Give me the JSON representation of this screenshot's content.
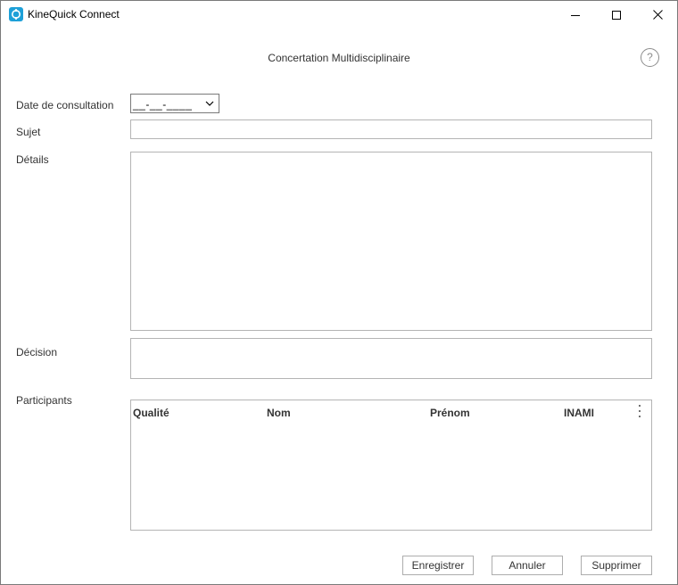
{
  "window": {
    "title": "KineQuick Connect",
    "icon": "kinequick-app-icon",
    "controls": [
      "minimize-icon",
      "maximize-icon",
      "close-icon"
    ]
  },
  "dialog": {
    "title": "Concertation Multidisciplinaire",
    "help_label": "?"
  },
  "form": {
    "date_label": "Date de consultation",
    "date_value": "__-__-____",
    "subject_label": "Sujet",
    "subject_value": "",
    "details_label": "Détails",
    "details_value": "",
    "decision_label": "Décision",
    "decision_value": "",
    "participants_label": "Participants"
  },
  "participants_table": {
    "columns": [
      "Qualité",
      "Nom",
      "Prénom",
      "INAMI"
    ],
    "rows": []
  },
  "buttons": {
    "save": "Enregistrer",
    "cancel": "Annuler",
    "delete": "Supprimer"
  },
  "colors": {
    "accent": "#1ea0d8",
    "border": "#b4b4b4",
    "text": "#333333"
  }
}
